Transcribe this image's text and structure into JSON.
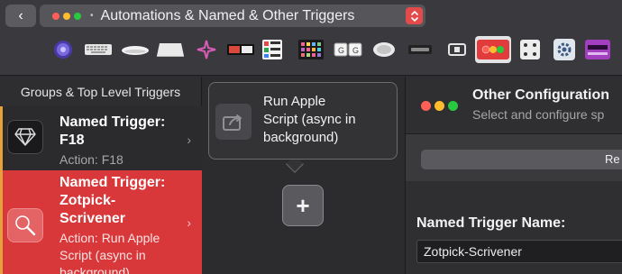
{
  "toolbar": {
    "back_glyph": "‹",
    "preset": {
      "bullet": "•",
      "label": "Automations & Named & Other Triggers",
      "dot_colors": [
        "#ff5f57",
        "#febc2e",
        "#28c840"
      ],
      "stepper_glyph": "⌃⌄",
      "stepper_color": "#e34b4b"
    },
    "devices": [
      {
        "name": "siri-remote-icon"
      },
      {
        "name": "keyboard-icon"
      },
      {
        "name": "magic-mouse-icon"
      },
      {
        "name": "trackpad-icon"
      },
      {
        "name": "leap-motion-icon"
      },
      {
        "name": "touch-bar-icon"
      },
      {
        "name": "stream-deck-icon"
      },
      {
        "name": "midi-icon"
      },
      {
        "name": "key-sequence-icon"
      },
      {
        "name": "normal-mouse-icon"
      },
      {
        "name": "bluetooth-remote-icon"
      },
      {
        "name": "automations-icon",
        "selected": true
      },
      {
        "name": "drawings-icon"
      },
      {
        "name": "other-settings-icon"
      },
      {
        "name": "notch-bar-icon"
      }
    ]
  },
  "sidebar": {
    "header": "Groups & Top Level Triggers",
    "items": [
      {
        "title_line1": "Named Trigger:",
        "title_line2": "F18",
        "action": "Action: F18",
        "icon": "diamond-icon",
        "accent": "#e5a13a"
      },
      {
        "title_line1": "Named Trigger:",
        "title_line2": "Zotpick-",
        "title_line3": "Scrivener",
        "action_line1": "Action: Run Apple",
        "action_line2": "Script (async in",
        "action_line3": "background)",
        "icon": "magnifier-icon",
        "accent": "#e5a13a",
        "bg": "#d9383b"
      }
    ]
  },
  "middle": {
    "popover": {
      "line1": "Run Apple",
      "line2": "Script (async in",
      "line3": "background)",
      "icon": "share-arrow-icon"
    },
    "add_label": "+"
  },
  "config": {
    "dot_colors": [
      "#ff5f57",
      "#febc2e",
      "#28c840"
    ],
    "title": "Other Configuration",
    "subtitle": "Select and configure sp",
    "button_label": "Re",
    "name_label": "Named Trigger Name:",
    "name_value": "Zotpick-Scrivener"
  }
}
